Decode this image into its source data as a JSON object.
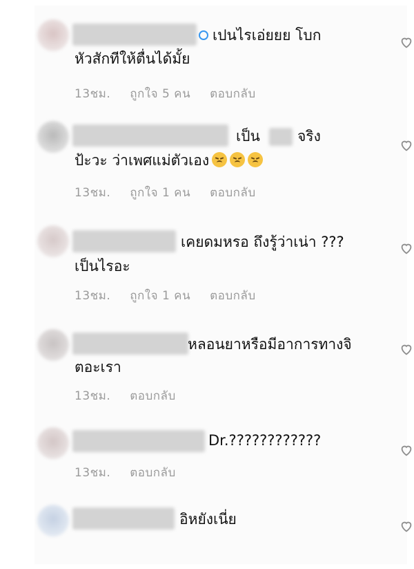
{
  "comments": [
    {
      "line1": "เปนไรเอ่ยยย โบก",
      "line2": "หัวสักทีให้ตื่นได้มั้ย",
      "time": "13ชม.",
      "likes": "ถูกใจ 5 คน",
      "reply": "ตอบกลับ"
    },
    {
      "line1a": "เป็น",
      "line1b": "จริง",
      "line2": "ป้ะวะ ว่าเพศแม่ตัวเอง",
      "time": "13ชม.",
      "likes": "ถูกใจ 1 คน",
      "reply": "ตอบกลับ"
    },
    {
      "line1": "เคยดมหรอ ถึงรู้ว่าเน่า ???",
      "line2": "เป็นไรอะ",
      "time": "13ชม.",
      "likes": "ถูกใจ 1 คน",
      "reply": "ตอบกลับ"
    },
    {
      "line1": "หลอนยาหรือมีอาการทางจิ",
      "line2": "ตอะเรา",
      "time": "13ชม.",
      "reply": "ตอบกลับ"
    },
    {
      "line1": "Dr.????????????",
      "time": "13ชม.",
      "reply": "ตอบกลับ"
    },
    {
      "line1": "อิหยังเนี่ย"
    }
  ],
  "icons": {
    "heart": "heart-outline-icon",
    "verified": "verified-badge-icon",
    "emoji": "disappointed-face-emoji"
  }
}
